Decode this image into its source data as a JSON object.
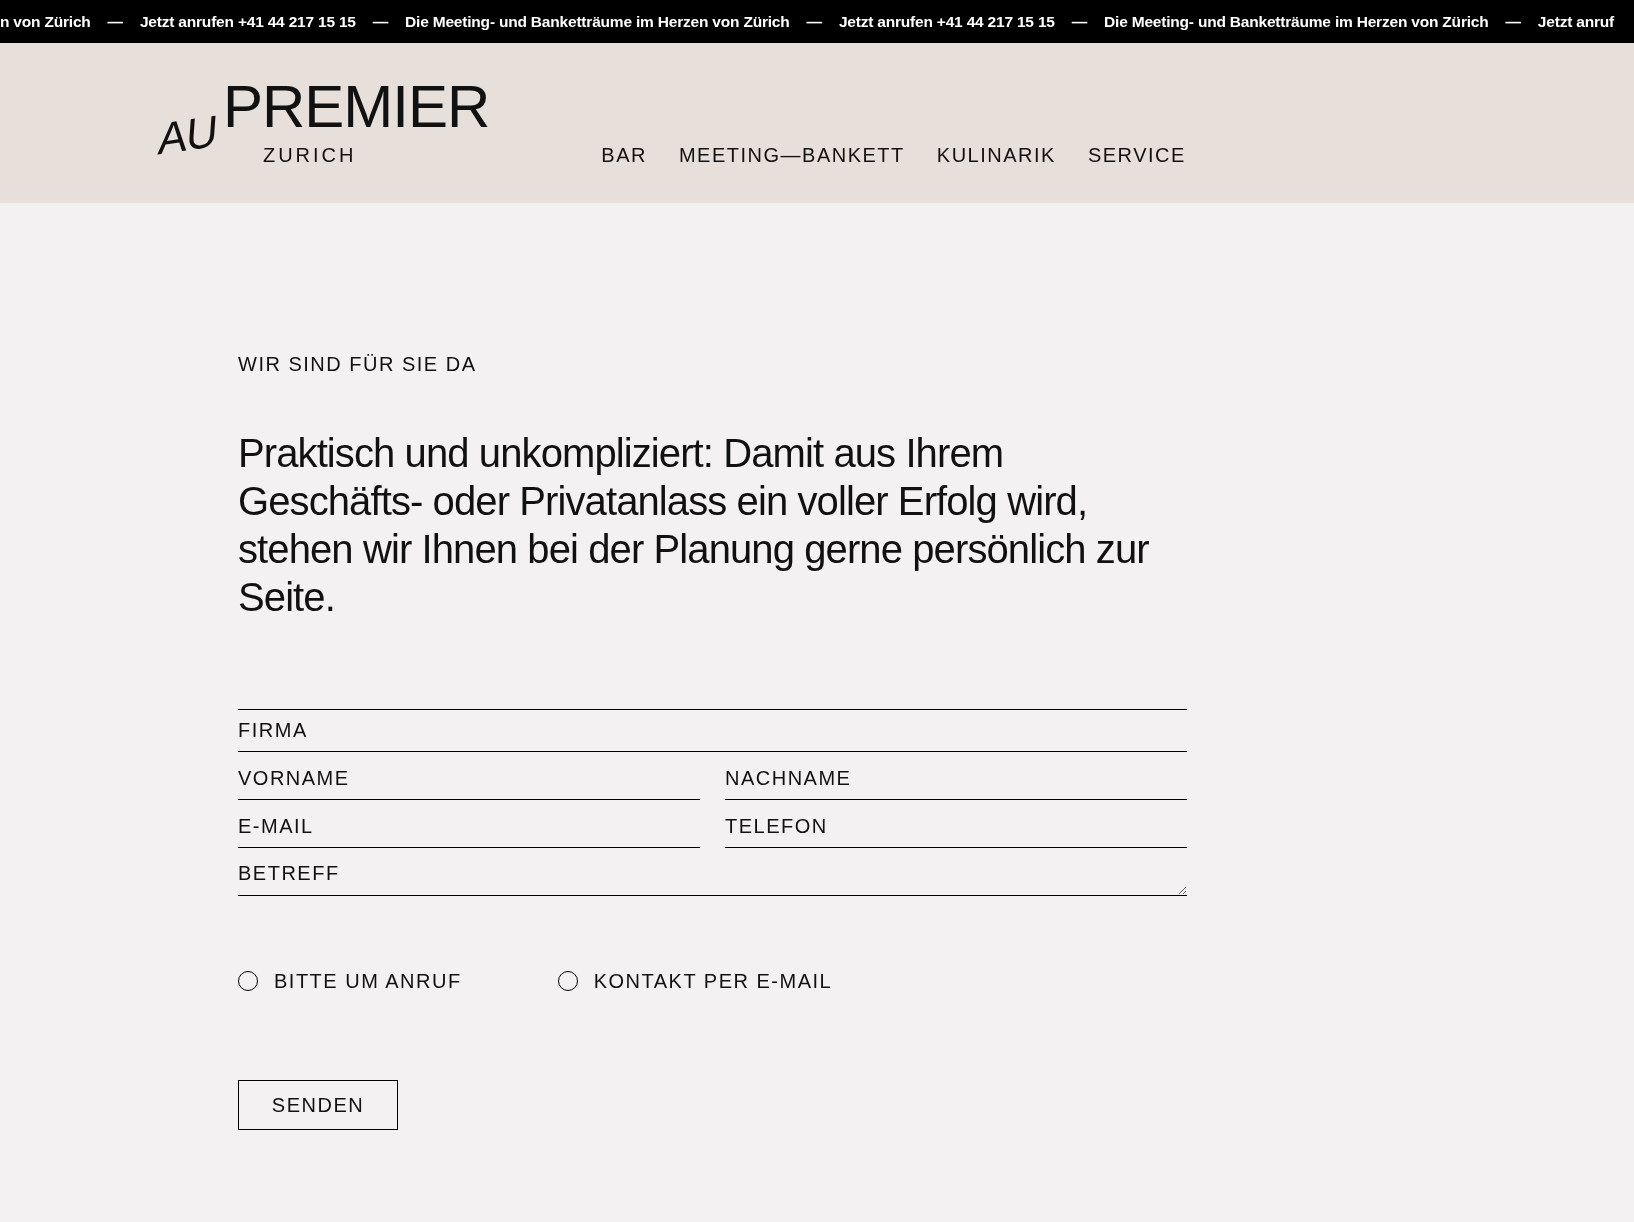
{
  "ticker": [
    "n von Zürich",
    "—",
    "Jetzt anrufen +41 44 217 15 15",
    "—",
    "Die Meeting- und Banketträume im Herzen von Zürich",
    "—",
    "Jetzt anrufen +41 44 217 15 15",
    "—",
    "Die Meeting- und Banketträume im Herzen von Zürich",
    "—",
    "Jetzt anruf"
  ],
  "logo": {
    "prefix": "AU",
    "name": "PREMIER",
    "city": "ZURICH"
  },
  "nav": [
    "BAR",
    "MEETING—BANKETT",
    "KULINARIK",
    "SERVICE"
  ],
  "eyebrow": "WIR SIND FÜR SIE DA",
  "intro": "Praktisch und unkompliziert: Damit aus Ihrem Geschäfts- oder Privatanlass ein voller Erfolg wird, stehen wir Ihnen bei der Planung gerne persönlich zur Seite.",
  "form": {
    "rows": [
      [
        {
          "kind": "input",
          "placeholder": "FIRMA"
        }
      ],
      [
        {
          "kind": "input",
          "placeholder": "VORNAME"
        },
        {
          "kind": "input",
          "placeholder": "NACHNAME"
        }
      ],
      [
        {
          "kind": "input",
          "placeholder": "E-MAIL"
        },
        {
          "kind": "input",
          "placeholder": "TELEFON"
        }
      ],
      [
        {
          "kind": "textarea",
          "placeholder": "BETREFF"
        }
      ]
    ],
    "options": [
      {
        "label": "BITTE UM ANRUF",
        "selected": false
      },
      {
        "label": "KONTAKT PER E-MAIL",
        "selected": false
      }
    ],
    "submit": "SENDEN"
  }
}
